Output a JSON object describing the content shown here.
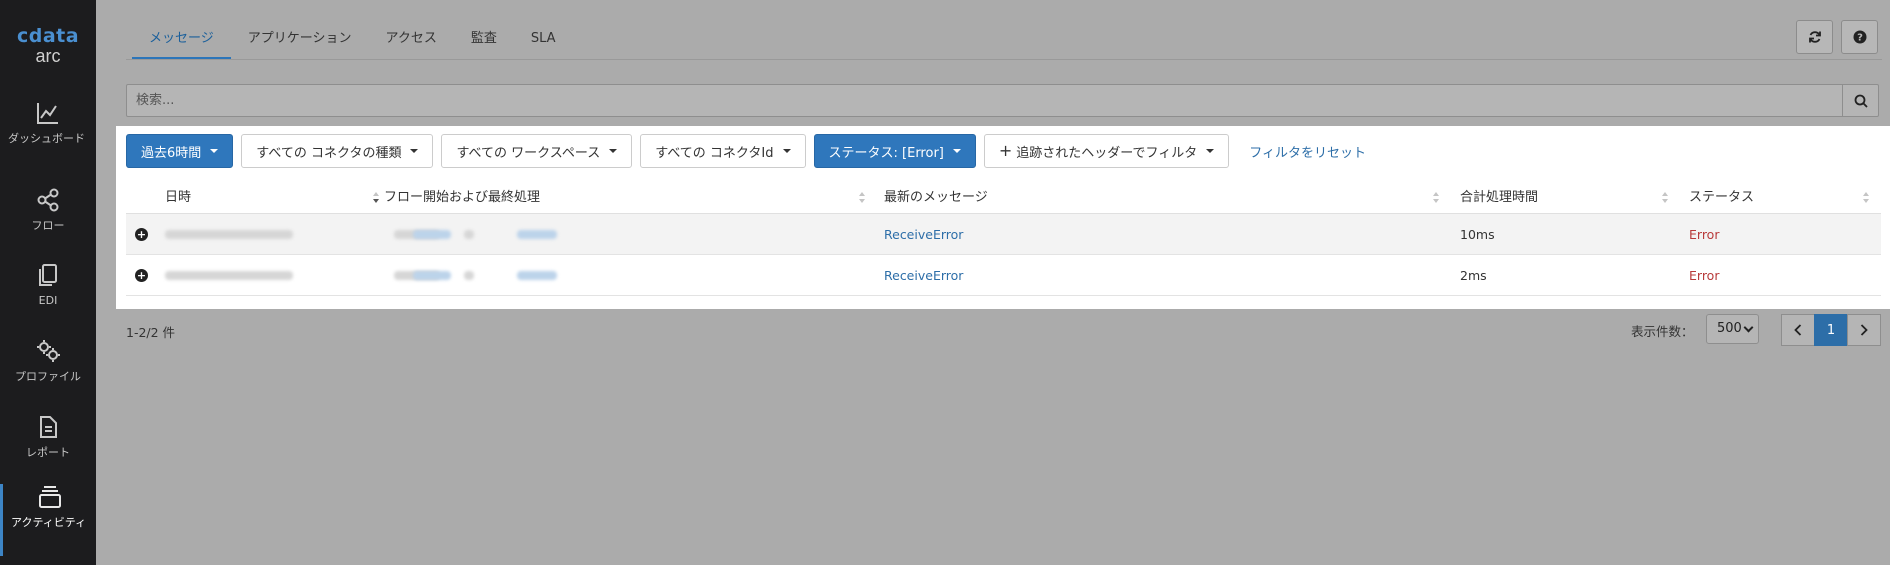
{
  "sidebar": {
    "logo_top": "cdata",
    "logo_bottom": "arc",
    "items": [
      {
        "label": "ダッシュボード",
        "icon": "chart-line-icon"
      },
      {
        "label": "フロー",
        "icon": "share-nodes-icon"
      },
      {
        "label": "EDI",
        "icon": "documents-icon"
      },
      {
        "label": "プロファイル",
        "icon": "gears-icon"
      },
      {
        "label": "レポート",
        "icon": "report-file-icon"
      },
      {
        "label": "アクティビティ",
        "icon": "activity-stack-icon",
        "active": true
      }
    ]
  },
  "tabs": [
    {
      "label": "メッセージ",
      "active": true
    },
    {
      "label": "アプリケーション"
    },
    {
      "label": "アクセス"
    },
    {
      "label": "監査"
    },
    {
      "label": "SLA"
    }
  ],
  "search": {
    "placeholder": "検索..."
  },
  "filters": {
    "time": "過去6時間",
    "connector_type": "すべての コネクタの種類",
    "workspace": "すべての ワークスペース",
    "connector_id": "すべての コネクタId",
    "status": "ステータス: [Error]",
    "add_header_filter": "追跡されたヘッダーでフィルタ",
    "reset": "フィルタをリセット"
  },
  "table": {
    "headers": [
      "日時",
      "フロー開始および最終処理",
      "最新のメッセージ",
      "合計処理時間",
      "ステータス"
    ],
    "rows": [
      {
        "latest_message": "ReceiveError",
        "total_time": "10ms",
        "status": "Error"
      },
      {
        "latest_message": "ReceiveError",
        "total_time": "2ms",
        "status": "Error"
      }
    ]
  },
  "footer": {
    "count": "1-2/2 件",
    "page_size_label": "表示件数：",
    "page_size": "500",
    "current_page": "1"
  },
  "colors": {
    "primary": "#2f77bc",
    "link": "#2d6ea8",
    "error": "#b83b3b",
    "sidebar_bg": "#1c1c1e",
    "overlay": "#ababab"
  }
}
